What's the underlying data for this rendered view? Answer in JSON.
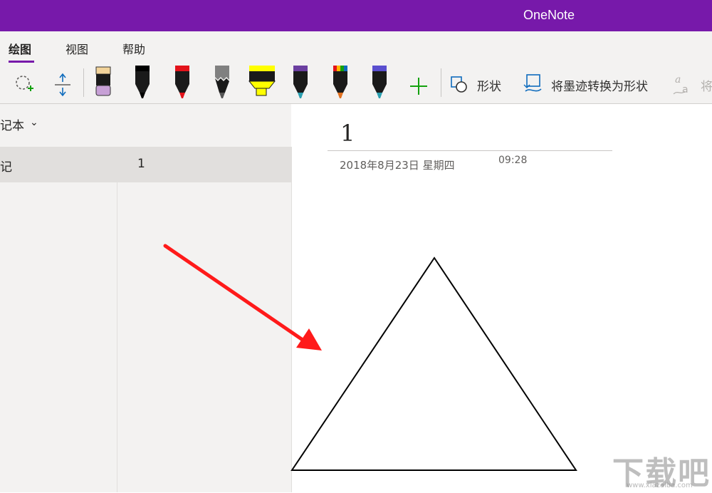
{
  "app": {
    "title": "OneNote"
  },
  "tabs": [
    {
      "label": "绘图"
    },
    {
      "label": "视图"
    },
    {
      "label": "帮助"
    }
  ],
  "ribbon": {
    "shapes_label": "形状",
    "ink_to_shape_label": "将墨迹转换为形状",
    "ink_to_text_label": "将",
    "pens": [
      {
        "name": "eraser",
        "color": "#c7a0d6"
      },
      {
        "name": "pen-black",
        "color": "#000000"
      },
      {
        "name": "pen-red",
        "color": "#e3131b"
      },
      {
        "name": "pencil-gray",
        "color": "#808080"
      },
      {
        "name": "highlighter-yellow",
        "color": "#ffff00"
      },
      {
        "name": "galaxy-pen-purple",
        "color": "#6b3fa0"
      },
      {
        "name": "galaxy-pen-rainbow",
        "color": "#e07020"
      },
      {
        "name": "galaxy-pen-teal",
        "color": "#2a9fb0"
      }
    ]
  },
  "nav": {
    "notebook_label": "记本",
    "section_label": "记",
    "page_label": "1"
  },
  "page": {
    "title": "1",
    "date": "2018年8月23日 星期四",
    "time": "09:28"
  },
  "watermark": {
    "text": "下载吧",
    "url": "www.xiazaiba.com"
  },
  "colors": {
    "titlebar": "#7719aa",
    "arrow": "#ff1a1a"
  }
}
